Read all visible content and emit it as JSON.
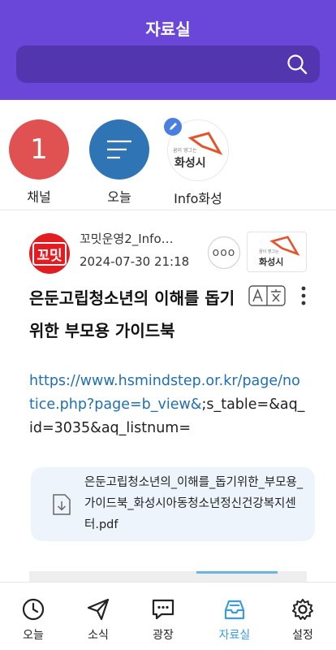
{
  "header": {
    "title": "자료실"
  },
  "search": {
    "icon": "search-icon"
  },
  "quick_items": [
    {
      "label": "채널",
      "badge": "1",
      "color": "#e05252"
    },
    {
      "label": "오늘",
      "color": "#2f75b5"
    },
    {
      "label": "Info화성",
      "logo_caption": "꿈이 영그는",
      "logo_text": "화성시"
    }
  ],
  "post": {
    "avatar_text": "꼬밋",
    "author": "꼬밋운영2_Info…",
    "datetime": "2024-07-30 21:18",
    "more_label": "ooo",
    "thumb_caption": "꿈이 영그는",
    "thumb_text": "화성시",
    "title": "은둔고립청소년의 이해를 돕기 위한 부모용 가이드북",
    "link": "https://www.hsmindstep.or.kr/page/notice.php?page=b_view&",
    "link_tail": ";s_table=&aq_id=3035&aq_listnum=",
    "attachment": {
      "file_name": "은둔고립청소년의_이해를_돕기위한_부모용_가이드북_화성시아동청소년정신건강복지센터.pdf"
    }
  },
  "nav": [
    {
      "label": "오늘",
      "icon": "clock-icon"
    },
    {
      "label": "소식",
      "icon": "send-icon"
    },
    {
      "label": "광장",
      "icon": "chat-icon"
    },
    {
      "label": "자료실",
      "icon": "inbox-icon",
      "active": true
    },
    {
      "label": "설정",
      "icon": "gear-icon"
    }
  ],
  "colors": {
    "header": "#6a47d9",
    "search": "#5236b0",
    "active_nav": "#3d9be0",
    "link": "#1f6fb2"
  }
}
